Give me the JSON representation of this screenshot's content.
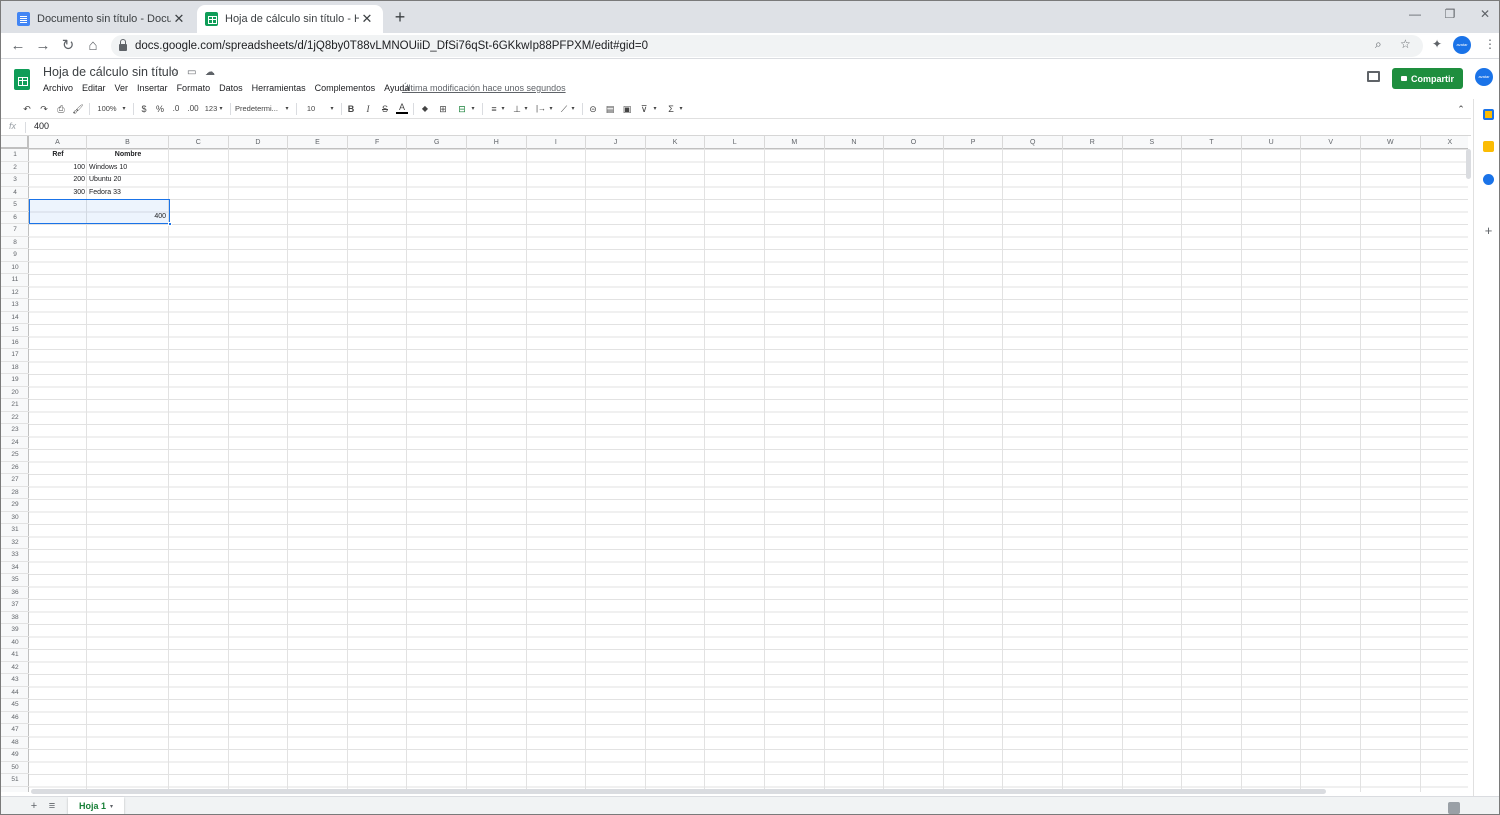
{
  "browser": {
    "tabs": [
      {
        "title": "Documento sin título - Documen",
        "icon": "docs-icon",
        "active": false
      },
      {
        "title": "Hoja de cálculo sin título - Hojas",
        "icon": "sheets-icon",
        "active": true
      }
    ],
    "new_tab": "+",
    "url": "docs.google.com/spreadsheets/d/1jQ8by0T88vLMNOUiiD_DfSi76qSt-6GKkwIp88PFPXM/edit#gid=0",
    "window_controls": {
      "minimize": "—",
      "restore": "❐",
      "close": "✕"
    },
    "nav": {
      "back": "←",
      "forward": "→",
      "reload": "↻",
      "home": "⌂"
    },
    "omni_icons": {
      "zoom": "⌕",
      "star": "☆",
      "extensions": "✦",
      "menu": "⋮"
    },
    "avatar_text": "avatar"
  },
  "sheets": {
    "title": "Hoja de cálculo sin título",
    "title_icons": {
      "star": "☆",
      "move": "▭",
      "cloud": "☁"
    },
    "menu": [
      "Archivo",
      "Editar",
      "Ver",
      "Insertar",
      "Formato",
      "Datos",
      "Herramientas",
      "Complementos",
      "Ayuda"
    ],
    "last_edit": "Última modificación hace unos segundos",
    "share_label": "Compartir",
    "avatar_text": "avatar",
    "accent": "#1e8e3e",
    "selection_color": "#1a73e8"
  },
  "toolbar": {
    "undo": "↶",
    "redo": "↷",
    "print": "⎙",
    "paint_format": "🖌",
    "zoom": "100%",
    "currency": "$",
    "percent": "%",
    "dec_decrease": ".0",
    "dec_increase": ".00",
    "more_formats": "123",
    "font": "Predetermi...",
    "font_size": "10",
    "bold": "B",
    "italic": "I",
    "strike": "S",
    "text_color": "A",
    "fill": "◆",
    "borders": "⊞",
    "merge": "⊟",
    "halign": "≡",
    "valign": "⊥",
    "wrap": "|→",
    "rotate": "⟋",
    "link": "⊝",
    "comment": "▤",
    "chart": "▣",
    "filter": "⊽",
    "functions": "Σ",
    "collapse": "⌃",
    "caret": "▾"
  },
  "formula_bar": {
    "fx": "fx",
    "value": "400"
  },
  "grid": {
    "columns": [
      "A",
      "B",
      "C",
      "D",
      "E",
      "F",
      "G",
      "H",
      "I",
      "J",
      "K",
      "L",
      "M",
      "N",
      "O",
      "P",
      "Q",
      "R",
      "S",
      "T",
      "U",
      "V",
      "W",
      "X"
    ],
    "rows": [
      "1",
      "2",
      "3",
      "4",
      "5",
      "6",
      "7",
      "8",
      "9",
      "10",
      "11",
      "12",
      "13",
      "14",
      "15",
      "16",
      "17",
      "18",
      "19",
      "20",
      "21",
      "22",
      "23",
      "24",
      "25",
      "26",
      "27",
      "28",
      "29",
      "30",
      "31",
      "32",
      "33",
      "34",
      "35",
      "36",
      "37",
      "38",
      "39",
      "40",
      "41",
      "42",
      "43",
      "44",
      "45",
      "46",
      "47",
      "48",
      "49",
      "50",
      "51"
    ],
    "header_ref": "Ref",
    "header_nombre": "Nombre",
    "data": [
      {
        "ref": "100",
        "nombre": "Windows 10"
      },
      {
        "ref": "200",
        "nombre": "Ubuntu 20"
      },
      {
        "ref": "300",
        "nombre": "Fedora 33"
      }
    ],
    "merged_value": "400"
  },
  "sheet_tabs": {
    "add": "+",
    "all_sheets": "≡",
    "active": "Hoja 1",
    "caret": "▾"
  }
}
